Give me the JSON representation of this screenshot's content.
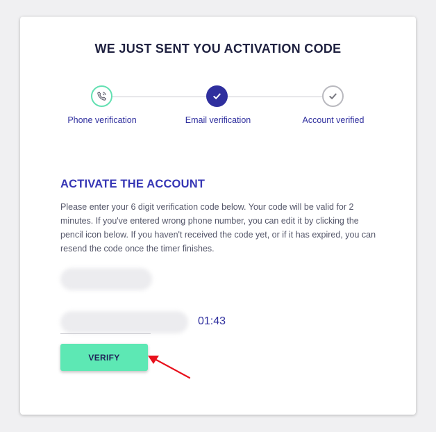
{
  "page": {
    "title": "WE JUST SENT YOU ACTIVATION CODE"
  },
  "stepper": {
    "steps": [
      {
        "label": "Phone verification",
        "icon": "phone-icon",
        "state": "active"
      },
      {
        "label": "Email verification",
        "icon": "check-icon",
        "state": "completed"
      },
      {
        "label": "Account verified",
        "icon": "check-icon",
        "state": "pending"
      }
    ]
  },
  "activation": {
    "heading": "ACTIVATE THE ACCOUNT",
    "description": "Please enter your 6 digit verification code below. Your code will be valid for 2 minutes. If you've entered wrong phone number, you can edit it by clicking the pencil icon below. If you haven't received the code yet, or if it has expired, you can resend the code once the timer finishes.",
    "timer": "01:43",
    "verify_label": "VERIFY"
  },
  "colors": {
    "accent": "#2f2f9e",
    "heading": "#3636b5",
    "button": "#5de8b4",
    "step_active_border": "#63e0b2",
    "annotation_arrow": "#e8101c"
  }
}
